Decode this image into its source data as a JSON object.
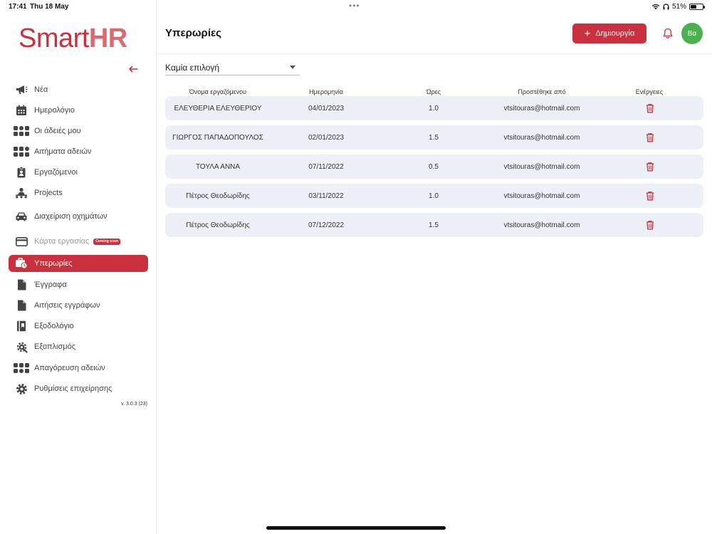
{
  "statusbar": {
    "time": "17:41",
    "date": "Thu 18 May",
    "battery": "51%",
    "battery_level": 0.51,
    "icons": [
      "wifi-icon",
      "headphones-icon",
      "battery-icon"
    ]
  },
  "brand": {
    "smart": "Smart",
    "hr": "HR",
    "accent": "#c8313d"
  },
  "sidebar": {
    "collapse_icon": "arrow-left-icon",
    "items": [
      {
        "label": "Νέα",
        "icon": "megaphone-icon"
      },
      {
        "label": "Ημερολόγιο",
        "icon": "calendar-icon"
      },
      {
        "label": "Οι άδειές μου",
        "icon": "grid-dots-icon"
      },
      {
        "label": "Αιτήματα αδειών",
        "icon": "grid-dots-icon"
      },
      {
        "label": "Εργαζόμενοι",
        "icon": "id-badge-icon"
      },
      {
        "label": "Projects",
        "icon": "team-icon"
      },
      {
        "label": "Διαχείριση οχημάτων",
        "icon": "car-icon"
      },
      {
        "label": "Κάρτα εργασίας",
        "icon": "credit-card-icon",
        "badge": "Coming soon"
      },
      {
        "label": "Υπερωρίες",
        "icon": "briefcase-clock-icon"
      },
      {
        "label": "Έγγραφα",
        "icon": "document-icon"
      },
      {
        "label": "Αιτήσεις εγγράφων",
        "icon": "document-icon"
      },
      {
        "label": "Εξοδολόγιο",
        "icon": "ledger-icon"
      },
      {
        "label": "Εξοπλισμός",
        "icon": "equipment-gear-icon"
      },
      {
        "label": "Απαγόρευση αδειών",
        "icon": "grid-dots-icon"
      },
      {
        "label": "Ρυθμίσεις επιχείρησης",
        "icon": "settings-gear-icon"
      }
    ],
    "active_index": 8,
    "version": "v. 3.0.3 (23)"
  },
  "header": {
    "title": "Υπερωρίες",
    "create_label": "Δημιουργία",
    "avatar_initials": "Βα",
    "avatar_color": "#4caf50"
  },
  "filter": {
    "value": "Καμία επιλογή"
  },
  "table": {
    "columns": [
      "Όνομα εργαζόμενου",
      "Ημερομηνία",
      "Ώρες",
      "Προστέθηκε από",
      "Ενέργειες"
    ],
    "rows": [
      {
        "name": "ΕΛΕΥΘΕΡΙΑ ΕΛΕΥΘΕΡΙΟΥ",
        "date": "04/01/2023",
        "hours": "1.0",
        "added_by": "vtsitouras@hotmail.com"
      },
      {
        "name": "ΓΙΩΡΓΟΣ ΠΑΠΑΔΟΠΟΥΛΟΣ",
        "date": "02/01/2023",
        "hours": "1.5",
        "added_by": "vtsitouras@hotmail.com"
      },
      {
        "name": "ΤΟΥΛΑ ΑΝΝΑ",
        "date": "07/11/2022",
        "hours": "0.5",
        "added_by": "vtsitouras@hotmail.com"
      },
      {
        "name": "Πέτρος Θεοδωρίδης",
        "date": "03/11/2022",
        "hours": "1.0",
        "added_by": "vtsitouras@hotmail.com"
      },
      {
        "name": "Πέτρος Θεοδωρίδης",
        "date": "07/12/2022",
        "hours": "1.5",
        "added_by": "vtsitouras@hotmail.com"
      }
    ]
  }
}
